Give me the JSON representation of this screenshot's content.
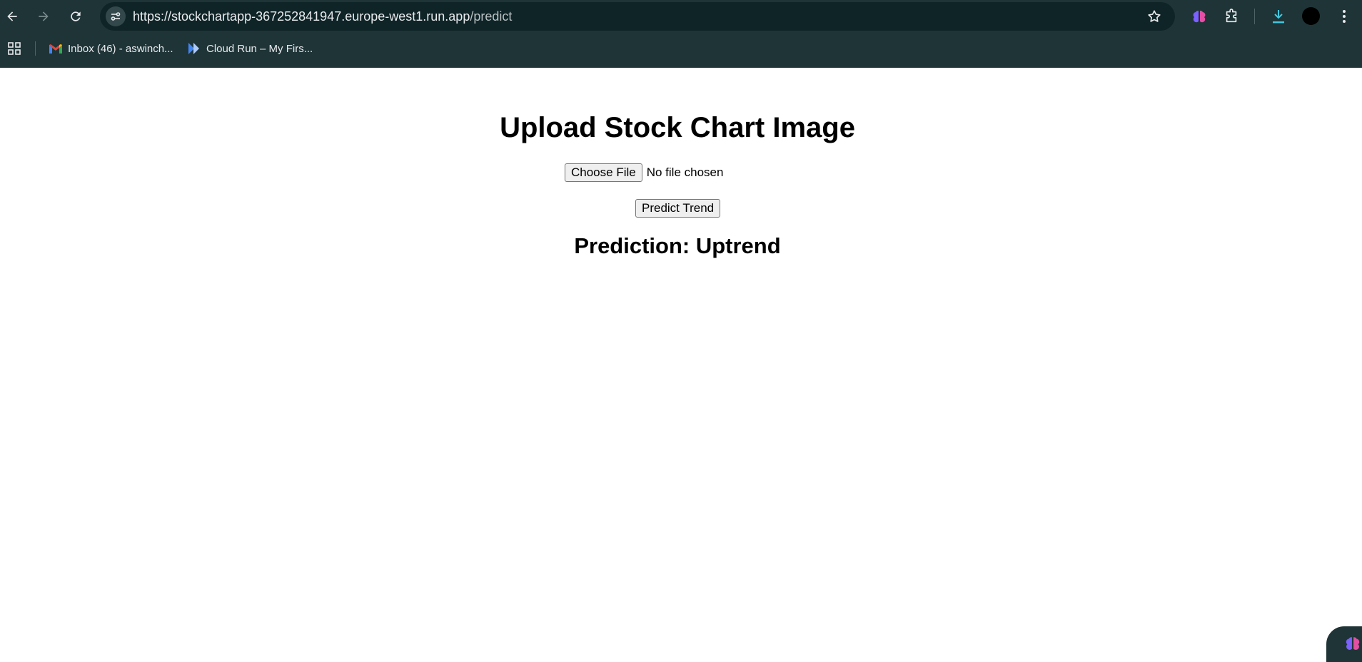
{
  "browser": {
    "url_host": "https://stockchartapp-367252841947.europe-west1.run.app",
    "url_path": "/predict",
    "bookmarks": [
      {
        "label": "Inbox (46) - aswinch..."
      },
      {
        "label": "Cloud Run – My Firs..."
      }
    ]
  },
  "page": {
    "title": "Upload Stock Chart Image",
    "choose_file_label": "Choose File",
    "file_status": "No file chosen",
    "predict_label": "Predict Trend",
    "prediction": "Prediction: Uptrend"
  },
  "colors": {
    "browser_chrome": "#1f3437",
    "omnibox": "#0f2427",
    "page_background": "#ffffff"
  },
  "icons": [
    "back-icon",
    "forward-icon",
    "reload-icon",
    "site-info-icon",
    "star-icon",
    "brain-extension-icon",
    "extensions-icon",
    "download-icon",
    "profile-avatar",
    "menu-icon",
    "apps-icon",
    "gmail-icon",
    "cloud-run-icon"
  ]
}
